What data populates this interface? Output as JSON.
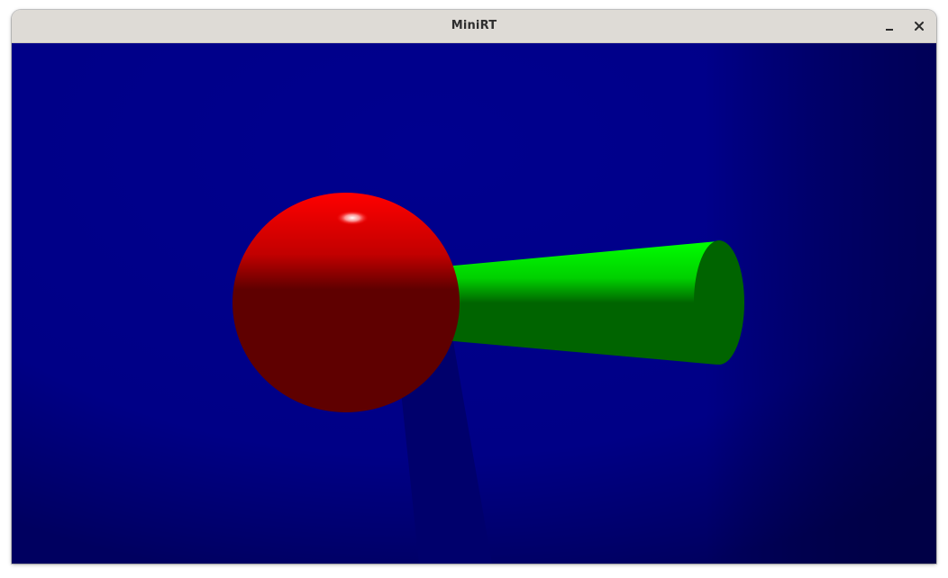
{
  "window": {
    "title": "MiniRT",
    "minimize_icon": "minimize-icon",
    "close_icon": "close-icon"
  },
  "scene": {
    "background_color": "#00008a",
    "objects": [
      {
        "type": "sphere",
        "color": "#ff0000",
        "shaded_color": "#5f0000"
      },
      {
        "type": "cylinder",
        "color": "#00ff00",
        "shaded_color": "#006400"
      }
    ],
    "shadow_color": "#000070"
  }
}
